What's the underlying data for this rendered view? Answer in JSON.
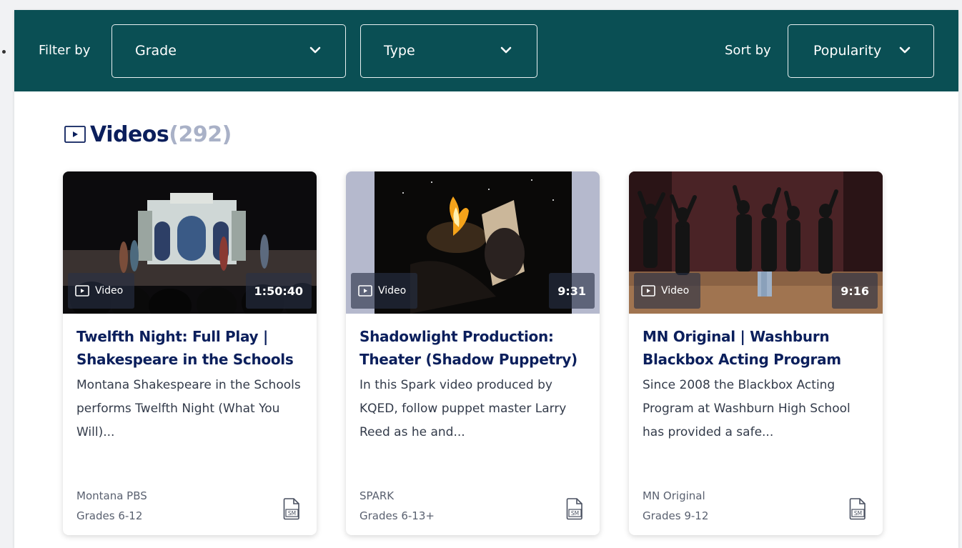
{
  "filters": {
    "filter_by_label": "Filter by",
    "grade_label": "Grade",
    "type_label": "Type",
    "sort_by_label": "Sort by",
    "sort_value": "Popularity"
  },
  "section": {
    "title": "Videos",
    "count": "(292)"
  },
  "cards": [
    {
      "badge_label": "Video",
      "duration": "1:50:40",
      "title": "Twelfth Night: Full Play | Shakespeare in the Schools",
      "description": "Montana Shakespeare in the Schools performs Twelfth Night (What You Will)...",
      "source": "Montana PBS",
      "grades": "Grades 6-12",
      "doc_icon_text": "SM"
    },
    {
      "badge_label": "Video",
      "duration": "9:31",
      "title": "Shadowlight Production: Theater (Shadow Puppetry)",
      "description": "In this Spark video produced by KQED, follow puppet master Larry Reed as he and...",
      "source": "SPARK",
      "grades": "Grades 6-13+",
      "doc_icon_text": "SM"
    },
    {
      "badge_label": "Video",
      "duration": "9:16",
      "title": "MN Original | Washburn Blackbox Acting Program",
      "description": "Since 2008 the Blackbox Acting Program at Washburn High School has provided a safe...",
      "source": "MN Original",
      "grades": "Grades 9-12",
      "doc_icon_text": "SM"
    }
  ],
  "colors": {
    "filter_bar": "#0a4f54",
    "title": "#0b1f5c",
    "count": "#a9b1c7"
  }
}
